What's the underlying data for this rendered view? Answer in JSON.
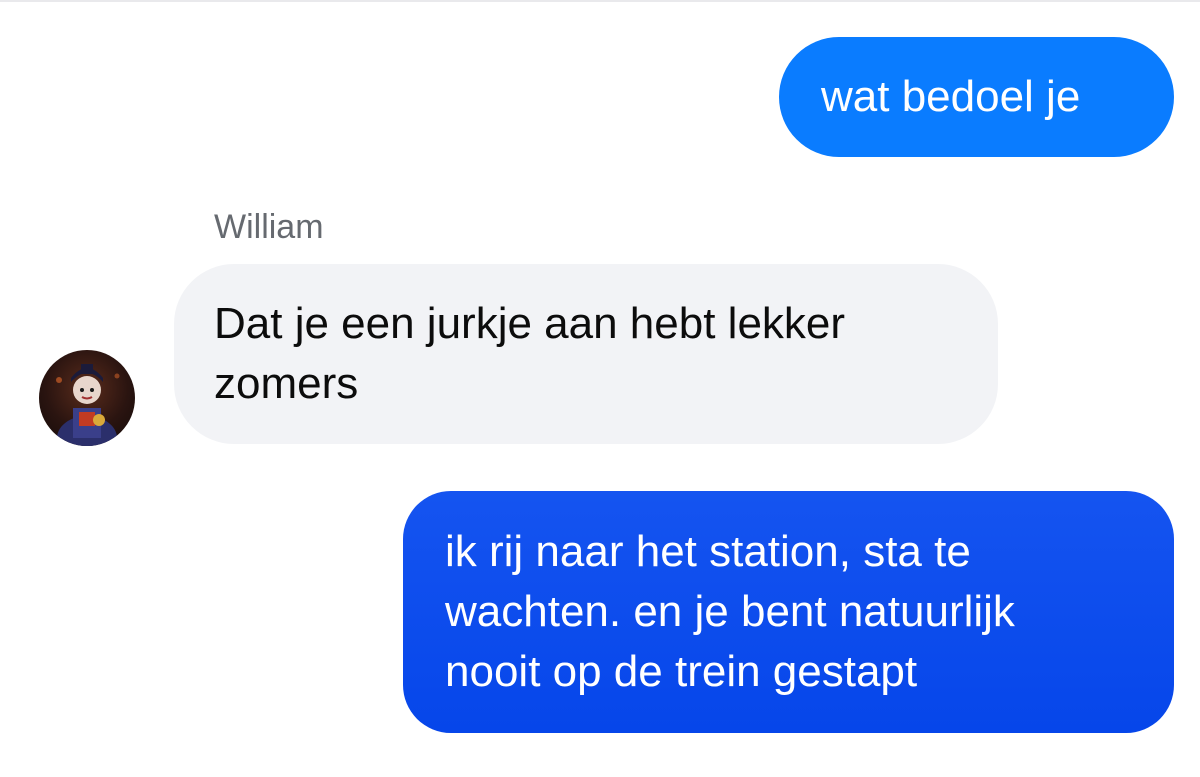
{
  "conversation": {
    "messages": [
      {
        "direction": "outgoing",
        "text": "wat bedoel je"
      },
      {
        "direction": "incoming",
        "sender": "William",
        "text": "Dat je een jurkje aan hebt lekker\nzomers"
      },
      {
        "direction": "outgoing",
        "text": "ik rij naar het station, sta te\nwachten. en je bent natuurlijk\nnooit op de trein gestapt"
      }
    ]
  },
  "colors": {
    "outgoing_bubble_light": "#0a7cff",
    "outgoing_bubble_dark": "#0646ea",
    "incoming_bubble": "#f2f3f6",
    "sender_name": "#666a70"
  },
  "icons": {
    "avatar": "sender-avatar-image"
  }
}
